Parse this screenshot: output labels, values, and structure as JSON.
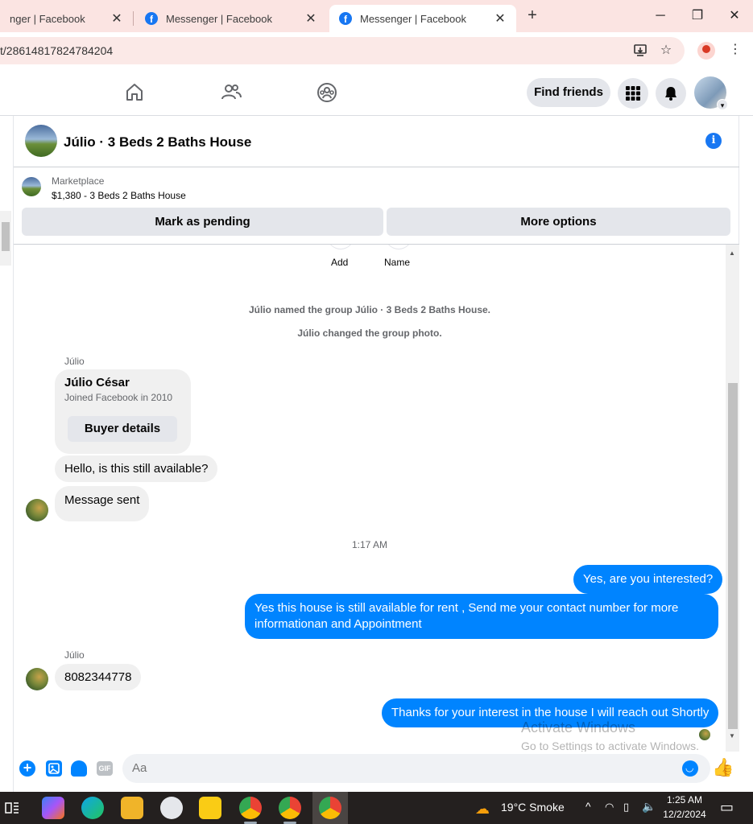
{
  "browser": {
    "tabs": [
      {
        "label": "nger | Facebook"
      },
      {
        "label": "Messenger | Facebook"
      },
      {
        "label": "Messenger | Facebook"
      }
    ],
    "url": "t/28614817824784204",
    "new_tab": "+",
    "controls": {
      "minimize": "─",
      "restore": "❐",
      "close": "✕"
    }
  },
  "fbnav": {
    "find_friends": "Find friends"
  },
  "chat": {
    "title": "Júlio · 3 Beds 2 Baths House",
    "info": "i",
    "marketplace": {
      "source": "Marketplace",
      "listing": "$1,380 - 3 Beds 2 Baths House",
      "mark_pending": "Mark as pending",
      "more_options": "More options"
    },
    "top_actions": {
      "add": "Add",
      "name": "Name"
    },
    "system_messages": [
      "Júlio named the group Júlio · 3 Beds 2 Baths House.",
      "Júlio changed the group photo."
    ],
    "sender_name": "Júlio",
    "profile_card": {
      "name": "Júlio César",
      "joined": "Joined Facebook in 2010",
      "buyer_details": "Buyer details"
    },
    "incoming_1": "Hello, is this still available?",
    "incoming_2": "Message sent",
    "timestamp": "1:17 AM",
    "outgoing_1": "Yes, are you interested?",
    "outgoing_2": "Yes this house is still available for rent , Send me your contact number for more informationan and Appointment",
    "sender_name_2": "Júlio",
    "incoming_3": "8082344778",
    "outgoing_3": "Thanks for your interest in the house I will reach out Shortly",
    "watermark_1": "Activate Windows",
    "watermark_2": "Go to Settings to activate Windows.",
    "composer": {
      "placeholder": "Aa",
      "gif": "GIF",
      "plus": "+",
      "like": "👍"
    }
  },
  "taskbar": {
    "weather": "19°C  Smoke",
    "time": "1:25 AM",
    "date": "12/2/2024"
  }
}
